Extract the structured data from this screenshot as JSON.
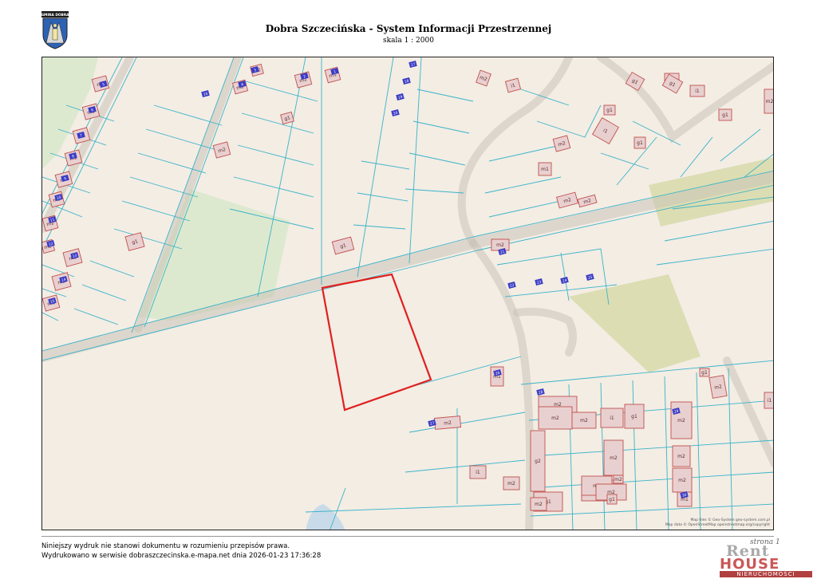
{
  "header": {
    "crest_text": "GMINA DOBRA",
    "title": "Dobra Szczecińska - System Informacji Przestrzennej",
    "scale": "skala 1 : 2000"
  },
  "map": {
    "attribution_line1": "Map tiles © Geo-System geo-system.com.pl",
    "attribution_line2": "Map data © OpenStreetMap openstreetmap.org/copyright",
    "colors": {
      "background": "#f3ede4",
      "parcel_line": "#3ab3c9",
      "road_line": "#c9c2b8",
      "building_fill": "#e9d0d0",
      "building_stroke": "#c0504d",
      "address_fill": "#3b3cc4",
      "meadow": "#dde9cf",
      "woodland": "#dcddb3",
      "selection": "#e02020",
      "water": "#c9dbe8"
    },
    "building_labels": [
      "m1",
      "m2",
      "m2",
      "m2",
      "m2",
      "m2",
      "m2",
      "m2",
      "m2",
      "m2",
      "m2",
      "m2",
      "m2",
      "m2",
      "m1",
      "m2",
      "g1",
      "g1",
      "i1",
      "m2",
      "m2",
      "m1",
      "g1",
      "i1",
      "g1",
      "i1",
      "g1",
      "g1",
      "g1",
      "i1",
      "g1",
      "m2",
      "m2",
      "m2",
      "m2",
      "m2",
      "m2",
      "i1",
      "g1",
      "g2",
      "g1",
      "m2",
      "m2",
      "m2",
      "m1",
      "m2",
      "m2",
      "m2",
      "m2",
      "m1",
      "m2",
      "g1",
      "i1",
      "m2",
      "m2",
      "m2",
      "g1",
      "m2",
      "i1",
      "m2"
    ],
    "address_labels": [
      "1",
      "2",
      "3",
      "4",
      "5",
      "6",
      "7",
      "8",
      "9",
      "10",
      "11",
      "12",
      "13",
      "14",
      "15",
      "16",
      "17",
      "18",
      "19",
      "20",
      "21",
      "22",
      "23",
      "24",
      "25",
      "26",
      "27",
      "28",
      "29",
      "30"
    ]
  },
  "footer": {
    "disclaimer": "Niniejszy wydruk nie stanowi dokumentu w rozumieniu przepisów prawa.",
    "printed": "Wydrukowano w serwisie dobraszczecinska.e-mapa.net dnia 2026-01-23 17:36:28",
    "page": "strona 1"
  },
  "logo": {
    "line1": "Rent",
    "line2": "HOUSE",
    "line3": "NIERUCHOMOŚCI"
  }
}
